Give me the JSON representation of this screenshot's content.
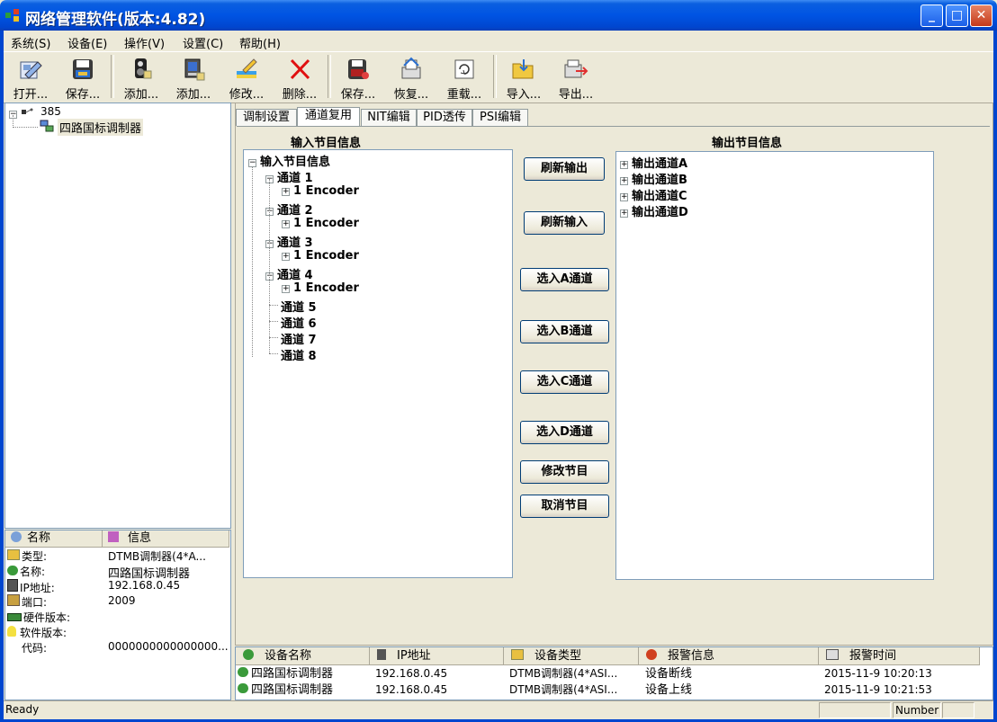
{
  "window": {
    "title": "网络管理软件(版本:4.82)",
    "minimize_glyph": "_",
    "maximize_glyph": "□",
    "close_glyph": "✕"
  },
  "menu": [
    "系统(S)",
    "设备(E)",
    "操作(V)",
    "设置(C)",
    "帮助(H)"
  ],
  "toolbar": [
    {
      "label": "打开...",
      "icon": "open-icon"
    },
    {
      "label": "保存...",
      "icon": "save-icon"
    },
    {
      "label": "添加...",
      "icon": "add-device-icon"
    },
    {
      "label": "添加...",
      "icon": "add-program-icon"
    },
    {
      "label": "修改...",
      "icon": "edit-icon"
    },
    {
      "label": "删除...",
      "icon": "delete-icon"
    },
    {
      "label": "保存...",
      "icon": "save-config-icon"
    },
    {
      "label": "恢复...",
      "icon": "restore-icon"
    },
    {
      "label": "重载...",
      "icon": "reload-icon"
    },
    {
      "label": "导入...",
      "icon": "import-icon"
    },
    {
      "label": "导出...",
      "icon": "export-icon"
    }
  ],
  "device_tree": {
    "root": "385",
    "child": "四路国标调制器"
  },
  "info_panel": {
    "col_name": "名称",
    "col_info": "信息",
    "rows": [
      {
        "key": "类型:",
        "value": "DTMB调制器(4*A..."
      },
      {
        "key": "名称:",
        "value": "四路国标调制器"
      },
      {
        "key": "IP地址:",
        "value": "192.168.0.45"
      },
      {
        "key": "端口:",
        "value": "2009"
      },
      {
        "key": "硬件版本:",
        "value": ""
      },
      {
        "key": "软件版本:",
        "value": ""
      },
      {
        "key": "代码:",
        "value": "0000000000000000..."
      }
    ]
  },
  "tabs": [
    "调制设置",
    "通道复用",
    "NIT编辑",
    "PID透传",
    "PSI编辑"
  ],
  "active_tab": "通道复用",
  "input_panel": {
    "title": "输入节目信息",
    "root": "输入节目信息",
    "channels": [
      {
        "name": "通道 1",
        "child": "1 Encoder"
      },
      {
        "name": "通道 2",
        "child": "1 Encoder"
      },
      {
        "name": "通道 3",
        "child": "1 Encoder"
      },
      {
        "name": "通道 4",
        "child": "1 Encoder"
      },
      {
        "name": "通道 5",
        "child": ""
      },
      {
        "name": "通道 6",
        "child": ""
      },
      {
        "name": "通道 7",
        "child": ""
      },
      {
        "name": "通道 8",
        "child": ""
      }
    ]
  },
  "output_panel": {
    "title": "输出节目信息",
    "channels": [
      "输出通道A",
      "输出通道B",
      "输出通道C",
      "输出通道D"
    ]
  },
  "actions": [
    "刷新输出",
    "刷新输入",
    "选入A通道",
    "选入B通道",
    "选入C通道",
    "选入D通道",
    "修改节目",
    "取消节目"
  ],
  "alarm_list": {
    "columns": [
      "设备名称",
      "IP地址",
      "设备类型",
      "报警信息",
      "报警时间"
    ],
    "rows": [
      [
        "四路国标调制器",
        "192.168.0.45",
        "DTMB调制器(4*ASI...",
        "设备断线",
        "2015-11-9 10:20:13"
      ],
      [
        "四路国标调制器",
        "192.168.0.45",
        "DTMB调制器(4*ASI...",
        "设备上线",
        "2015-11-9 10:21:53"
      ]
    ]
  },
  "statusbar": {
    "status": "Ready",
    "num": "Number"
  }
}
